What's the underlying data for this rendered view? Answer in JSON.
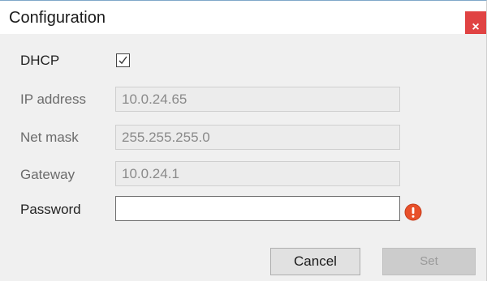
{
  "window": {
    "title": "Configuration",
    "close_glyph": "×"
  },
  "form": {
    "dhcp": {
      "label": "DHCP",
      "checked": true
    },
    "ip_address": {
      "label": "IP address",
      "value": "10.0.24.65"
    },
    "net_mask": {
      "label": "Net mask",
      "value": "255.255.255.0"
    },
    "gateway": {
      "label": "Gateway",
      "value": "10.0.24.1"
    },
    "password": {
      "label": "Password",
      "value": ""
    }
  },
  "buttons": {
    "cancel_label": "Cancel",
    "set_label": "Set"
  },
  "icons": {
    "checkbox": "check-icon",
    "password_error": "error-icon",
    "close": "close-icon"
  },
  "colors": {
    "close_button": "#e04343",
    "error_icon": "#e8502a",
    "title_border": "#7fa7c9"
  }
}
